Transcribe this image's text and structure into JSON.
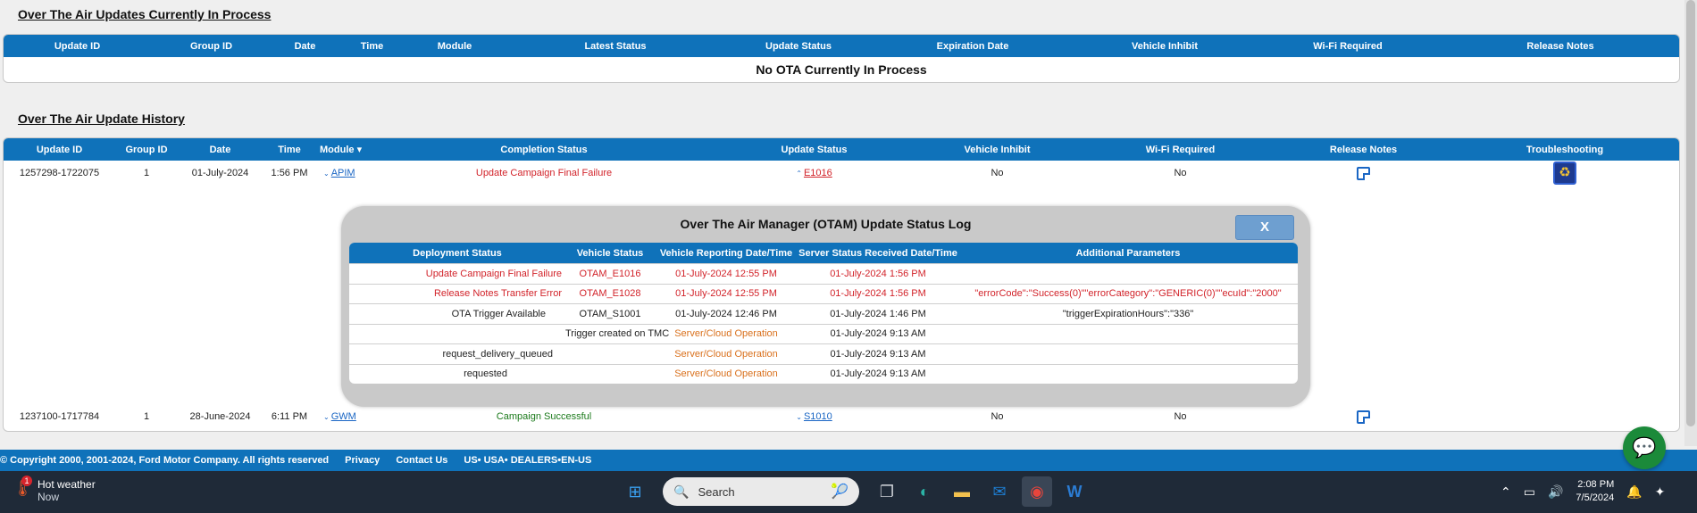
{
  "colors": {
    "header_blue": "#0f72ba",
    "link": "#1a66c4",
    "error_red": "#d2232a",
    "success_green": "#1b7a1b",
    "cloud_orange": "#d9701c"
  },
  "in_process": {
    "title": "Over The Air Updates Currently In Process",
    "columns": [
      "Update ID",
      "Group ID",
      "Date",
      "Time",
      "Module",
      "Latest Status",
      "Update Status",
      "Expiration Date",
      "Vehicle Inhibit",
      "Wi-Fi Required",
      "Release Notes"
    ],
    "empty_message": "No OTA Currently In Process"
  },
  "history": {
    "title": "Over The Air Update History",
    "columns": [
      "Update ID",
      "Group ID",
      "Date",
      "Time",
      "Module",
      "Completion Status",
      "Update Status",
      "Vehicle Inhibit",
      "Wi-Fi Required",
      "Release Notes",
      "Troubleshooting"
    ],
    "sort_icon": "caret-down-icon",
    "rows": [
      {
        "update_id": "1257298-1722075",
        "group_id": "1",
        "date": "01-July-2024",
        "time": "1:56 PM",
        "module": "APIM",
        "completion_status": "Update Campaign Final Failure",
        "update_status": "E1016",
        "vehicle_inhibit": "No",
        "wifi_required": "No"
      },
      {
        "update_id": "1237100-1717784",
        "group_id": "1",
        "date": "28-June-2024",
        "time": "6:11 PM",
        "module": "GWM",
        "completion_status": "Campaign Successful",
        "update_status": "S1010",
        "vehicle_inhibit": "No",
        "wifi_required": "No"
      }
    ]
  },
  "modal": {
    "title": "Over The Air Manager (OTAM) Update Status Log",
    "close_label": "X",
    "columns": [
      "Deployment Status",
      "Vehicle Status",
      "Vehicle Reporting Date/Time",
      "Server Status Received Date/Time",
      "Additional Parameters"
    ],
    "rows": [
      {
        "deployment": "Update Campaign Final Failure",
        "vehicle_status": "OTAM_E1016",
        "reporting": "01-July-2024 12:55 PM",
        "received": "01-July-2024 1:56 PM",
        "params": ""
      },
      {
        "deployment": "Release Notes Transfer Error",
        "vehicle_status": "OTAM_E1028",
        "reporting": "01-July-2024 12:55 PM",
        "received": "01-July-2024 1:56 PM",
        "params": "\"errorCode\":\"Success(0)\"\"errorCategory\":\"GENERIC(0)\"\"ecuId\":\"2000\""
      },
      {
        "deployment": "OTA Trigger Available",
        "vehicle_status": "OTAM_S1001",
        "reporting": "01-July-2024 12:46 PM",
        "received": "01-July-2024 1:46 PM",
        "params": "\"triggerExpirationHours\":\"336\""
      },
      {
        "deployment": "",
        "vehicle_status": "Trigger created on TMC",
        "reporting": "Server/Cloud Operation",
        "received": "01-July-2024 9:13 AM",
        "params": ""
      },
      {
        "deployment": "request_delivery_queued",
        "vehicle_status": "",
        "reporting": "Server/Cloud Operation",
        "received": "01-July-2024 9:13 AM",
        "params": ""
      },
      {
        "deployment": "requested",
        "vehicle_status": "",
        "reporting": "Server/Cloud Operation",
        "received": "01-July-2024 9:13 AM",
        "params": ""
      }
    ]
  },
  "footer": {
    "copyright": "© Copyright 2000, 2001-2024, Ford Motor Company. All rights reserved",
    "links": [
      "Privacy",
      "Contact Us",
      "US• USA• DEALERS•EN-US"
    ]
  },
  "taskbar": {
    "weather_title": "Hot weather",
    "weather_sub": "Now",
    "weather_badge": "1",
    "search_placeholder": "Search",
    "time": "2:08 PM",
    "date": "7/5/2024",
    "apps": [
      "windows-start-icon",
      "task-view-icon",
      "edge-icon",
      "file-explorer-icon",
      "outlook-icon",
      "chrome-icon",
      "word-icon"
    ]
  }
}
